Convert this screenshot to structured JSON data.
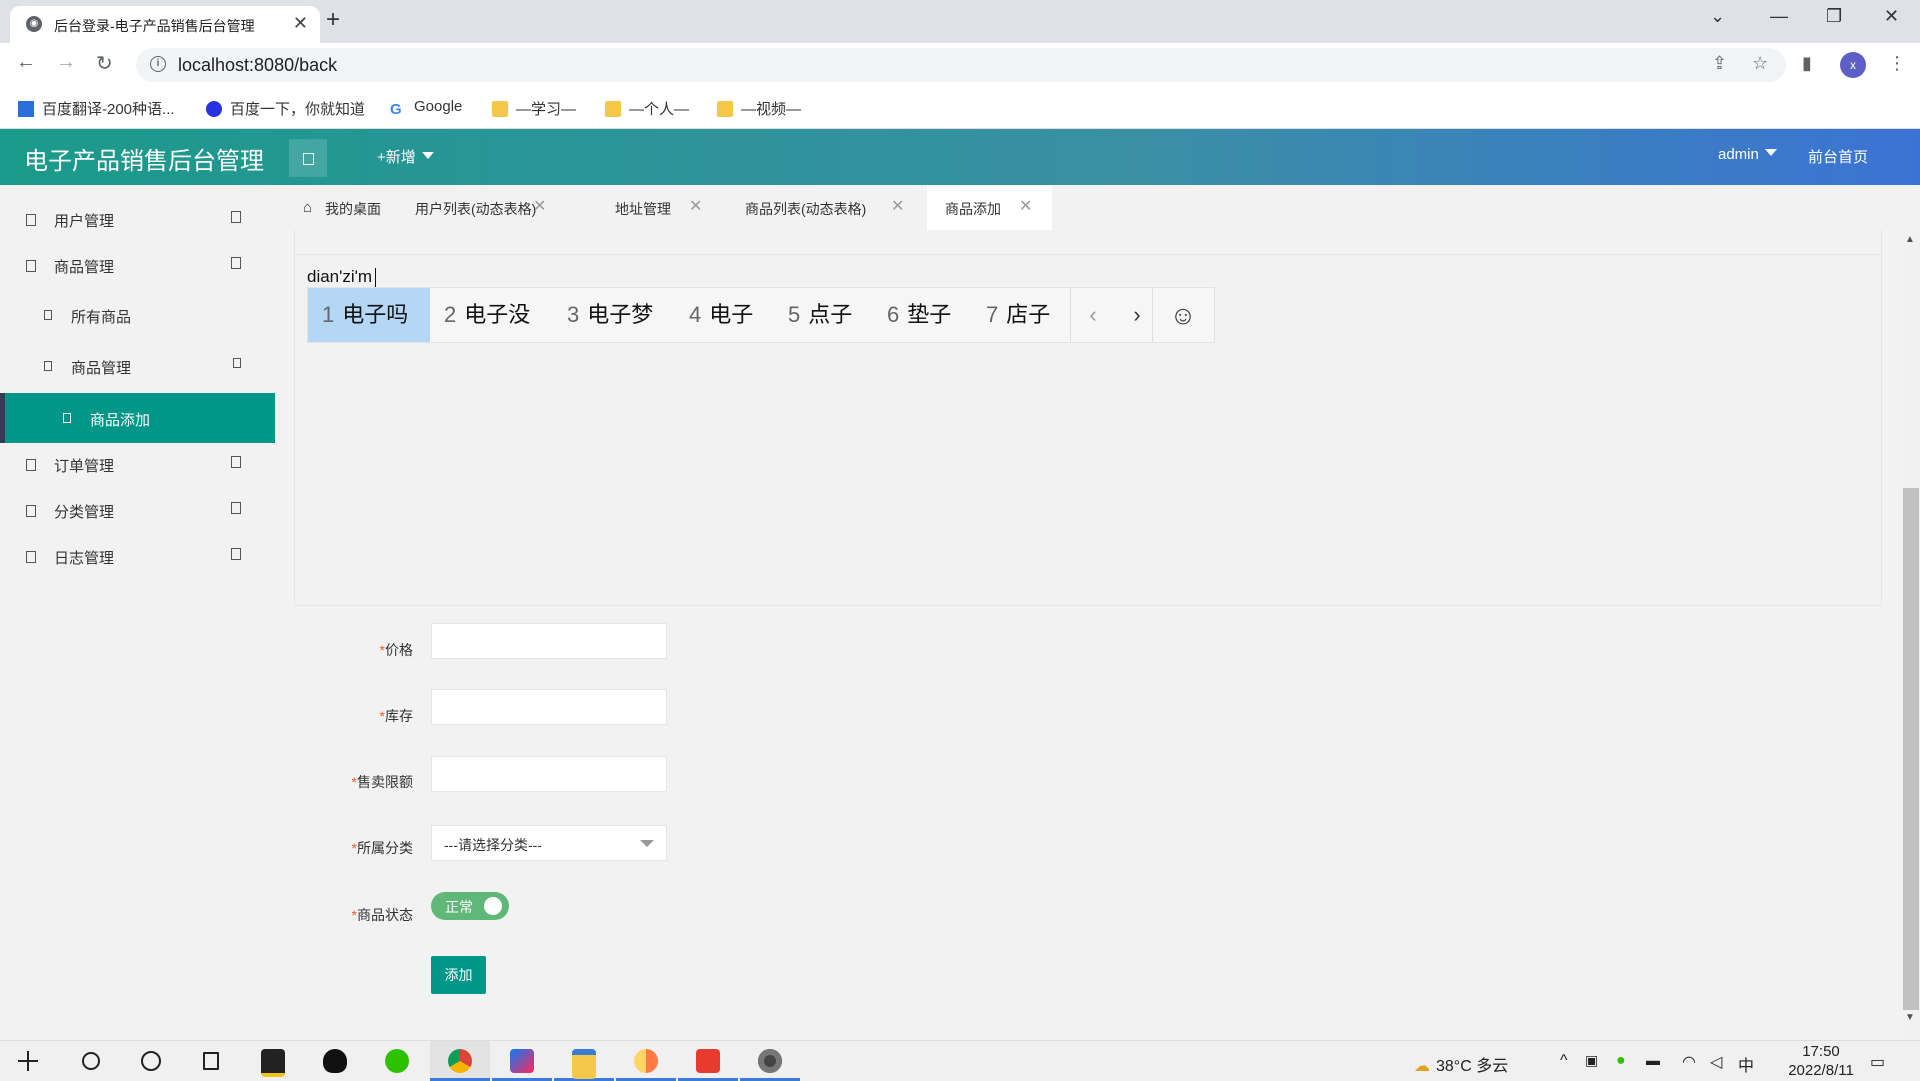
{
  "browser": {
    "tab_title": "后台登录-电子产品销售后台管理",
    "url": "localhost:8080/back",
    "profile_initial": "x",
    "bookmarks": [
      "百度翻译-200种语...",
      "百度一下，你就知道",
      "Google",
      "—学习—",
      "—个人—",
      "—视频—"
    ]
  },
  "header": {
    "logo": "电子产品销售后台管理",
    "add_new": "+新增",
    "user": "admin",
    "front_home": "前台首页"
  },
  "sidebar": {
    "items": [
      {
        "label": "用户管理"
      },
      {
        "label": "商品管理"
      },
      {
        "label": "所有商品"
      },
      {
        "label": "商品管理"
      },
      {
        "label": "商品添加"
      },
      {
        "label": "订单管理"
      },
      {
        "label": "分类管理"
      },
      {
        "label": "日志管理"
      }
    ]
  },
  "tabs": [
    {
      "label": "我的桌面"
    },
    {
      "label": "用户列表(动态表格)"
    },
    {
      "label": "地址管理"
    },
    {
      "label": "商品列表(动态表格)"
    },
    {
      "label": "商品添加"
    }
  ],
  "editor": {
    "text": "dian'zi'm"
  },
  "ime": {
    "candidates": [
      {
        "num": "1",
        "text": "电子吗"
      },
      {
        "num": "2",
        "text": "电子没"
      },
      {
        "num": "3",
        "text": "电子梦"
      },
      {
        "num": "4",
        "text": "电子"
      },
      {
        "num": "5",
        "text": "点子"
      },
      {
        "num": "6",
        "text": "垫子"
      },
      {
        "num": "7",
        "text": "店子"
      }
    ],
    "prev": "‹",
    "next": "›",
    "emoji": "☺"
  },
  "form": {
    "required_mark": "*",
    "price_label": "价格",
    "stock_label": "库存",
    "limit_label": "售卖限额",
    "category_label": "所属分类",
    "category_value": "---请选择分类---",
    "status_label": "商品状态",
    "status_value": "正常",
    "submit": "添加"
  },
  "taskbar": {
    "weather": "38°C 多云",
    "ime_mode": "中",
    "time": "17:50",
    "date": "2022/8/11"
  },
  "colors": {
    "accent": "#009688",
    "switch_on": "#5fb878",
    "ime_selected": "#b4d7f5"
  }
}
